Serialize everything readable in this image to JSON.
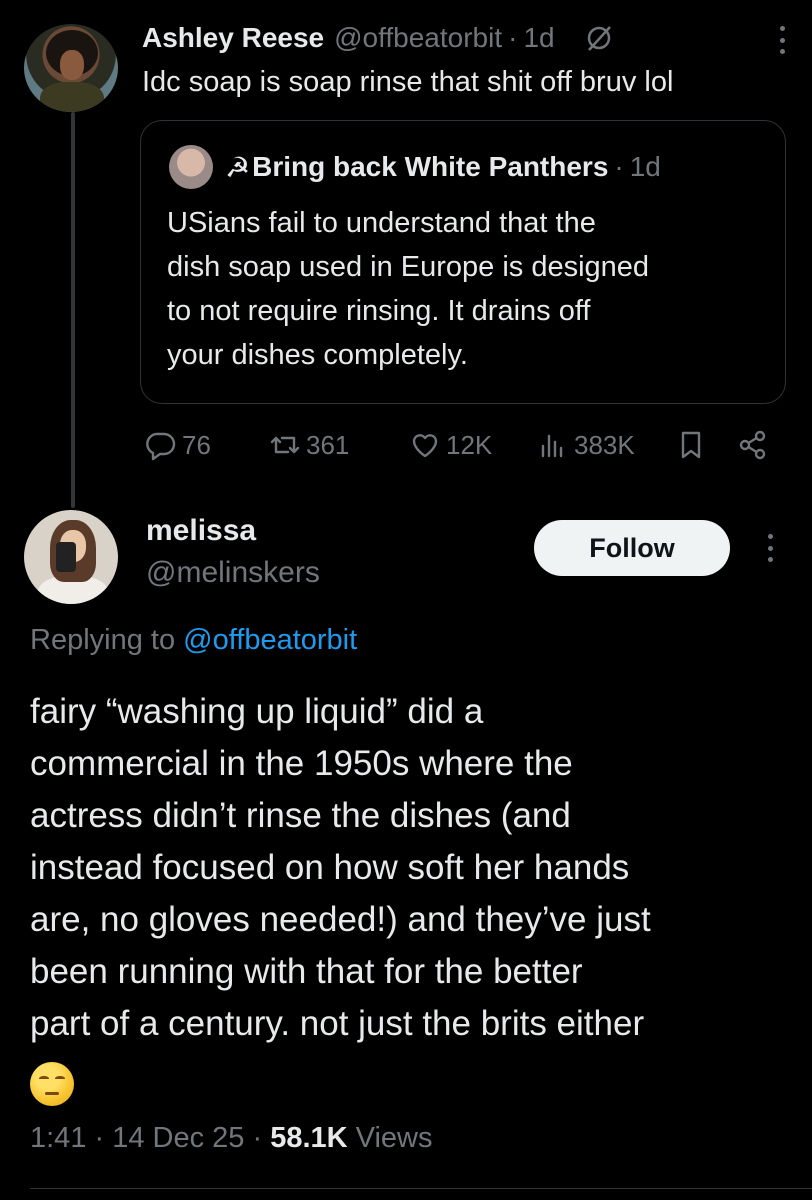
{
  "tweet": {
    "author_name": "Ashley Reese",
    "author_handle": "@offbeatorbit",
    "time": "1d",
    "text": "Idc soap is soap rinse that shit off bruv lol",
    "quote": {
      "author_icon": "☭",
      "author_name": "Bring back White Panthers",
      "time": "1d",
      "text": "USians fail to understand that the\ndish soap used in Europe is designed\nto not require rinsing.  It drains off\nyour dishes completely."
    },
    "stats": {
      "replies": "76",
      "reposts": "361",
      "likes": "12K",
      "views": "383K"
    }
  },
  "reply": {
    "author_name": "melissa",
    "author_handle": "@melinskers",
    "follow_label": "Follow",
    "replying_prefix": "Replying to ",
    "replying_to": "@offbeatorbit",
    "text": "fairy “washing up liquid” did a\ncommercial in the 1950s where the\nactress didn’t rinse the dishes (and\ninstead focused on how soft her hands\nare, no gloves needed!) and they’ve just\nbeen running with that for the better\npart of a century. not just the brits either",
    "emoji": "unamused-face-emoji",
    "time": "1:41",
    "date": "14 Dec 25",
    "views_count": "58.1K",
    "views_label": "Views"
  },
  "colors": {
    "background": "#000000",
    "text": "#e7e9ea",
    "muted": "#71767b",
    "link": "#1d9bf0",
    "border": "#2f3336"
  }
}
